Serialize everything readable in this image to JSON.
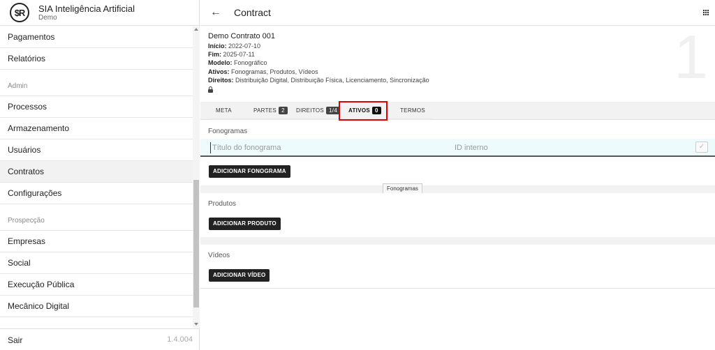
{
  "sidebar": {
    "logo_text": "$R",
    "app_title": "SIA Inteligência Artificial",
    "app_subtitle": "Demo",
    "items": [
      {
        "label": "Pagamentos"
      },
      {
        "label": "Relatórios"
      },
      {
        "section": "Admin"
      },
      {
        "label": "Processos"
      },
      {
        "label": "Armazenamento"
      },
      {
        "label": "Usuários"
      },
      {
        "label": "Contratos",
        "active": true
      },
      {
        "label": "Configurações"
      },
      {
        "section": "Prospecção"
      },
      {
        "label": "Empresas"
      },
      {
        "label": "Social"
      },
      {
        "label": "Execução Pública"
      },
      {
        "label": "Mecânico Digital"
      }
    ],
    "logout_label": "Sair",
    "version": "1.4.004"
  },
  "header": {
    "back_icon": "arrow-left-icon",
    "title": "Contract",
    "apps_icon": "apps-grid-icon"
  },
  "contract": {
    "number": "1",
    "name": "Demo Contrato 001",
    "start_label": "Início:",
    "start": "2022-07-10",
    "end_label": "Fim:",
    "end": "2025-07-11",
    "model_label": "Modelo:",
    "model": "Fonográfico",
    "assets_label": "Ativos:",
    "assets": "Fonogramas, Produtos, Vídeos",
    "rights_label": "Direitos:",
    "rights": "Distribuição Digital, Distribuição Física, Licenciamento, Sincronização"
  },
  "tabs": [
    {
      "label": "META"
    },
    {
      "label": "PARTES",
      "badge": "2"
    },
    {
      "label": "DIREITOS",
      "badge": "1/4"
    },
    {
      "label": "ATIVOS",
      "badge": "0",
      "active": true
    },
    {
      "label": "TERMOS"
    }
  ],
  "fonogramas": {
    "title": "Fonogramas",
    "title_placeholder": "Título do fonograma",
    "id_placeholder": "ID interno",
    "add_label": "ADICIONAR FONOGRAMA",
    "tooltip": "Fonogramas"
  },
  "produtos": {
    "title": "Produtos",
    "add_label": "ADICIONAR PRODUTO"
  },
  "videos": {
    "title": "Vídeos",
    "add_label": "ADICIONAR VÍDEO"
  },
  "colors": {
    "highlight": "#e00000",
    "button": "#222222",
    "input_bg": "#eefbfc"
  }
}
